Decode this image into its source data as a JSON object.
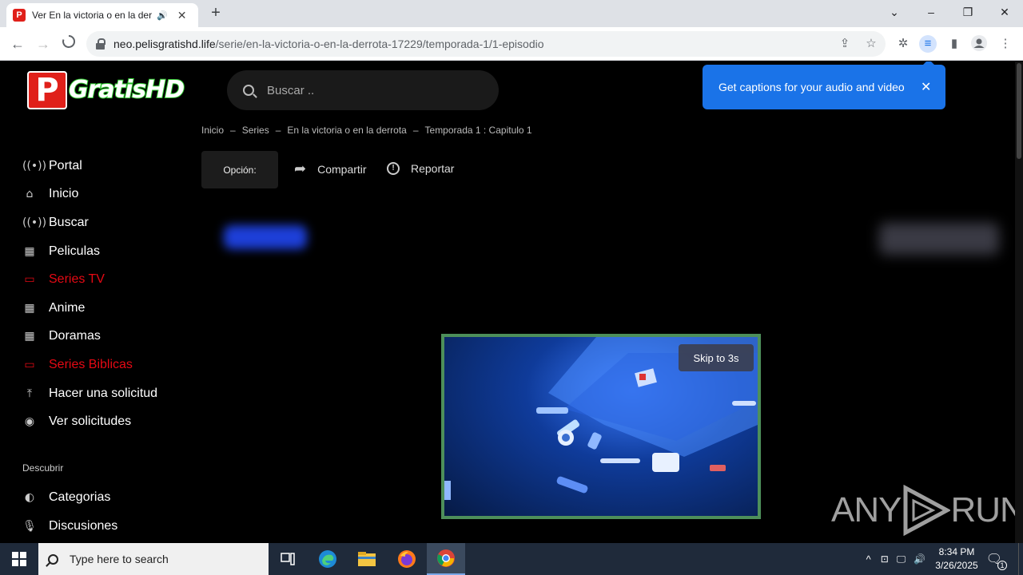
{
  "browser": {
    "tab": {
      "title": "Ver En la victoria o en la derrota",
      "favicon_letter": "P"
    },
    "window_controls": {
      "minimize": "–",
      "restore": "❐",
      "close": "✕"
    },
    "url": {
      "domain": "neo.pelisgratishd.life",
      "path": "/serie/en-la-victoria-o-en-la-derrota-17229/temporada-1/1-episodio"
    }
  },
  "site": {
    "logo": {
      "letter": "P",
      "text": "GratisHD"
    },
    "search": {
      "placeholder": "Buscar .."
    },
    "caption_popup": {
      "text": "Get captions for your audio and video"
    },
    "breadcrumb": [
      "Inicio",
      "Series",
      "En la victoria o en la derrota",
      "Temporada 1 : Capitulo 1"
    ],
    "breadcrumb_sep": "–",
    "actions": {
      "opcion": "Opción:",
      "compartir": "Compartir",
      "reportar": "Reportar"
    },
    "sidebar": {
      "items": [
        {
          "label": "Portal",
          "icon": "broadcast-icon",
          "active": false
        },
        {
          "label": "Inicio",
          "icon": "home-icon",
          "active": false
        },
        {
          "label": "Buscar",
          "icon": "broadcast-icon",
          "active": false
        },
        {
          "label": "Peliculas",
          "icon": "film-icon",
          "active": false
        },
        {
          "label": "Series TV",
          "icon": "tv-icon",
          "active": true
        },
        {
          "label": "Anime",
          "icon": "film-icon",
          "active": false
        },
        {
          "label": "Doramas",
          "icon": "film-icon",
          "active": false
        },
        {
          "label": "Series Biblicas",
          "icon": "tv-icon",
          "active": true
        },
        {
          "label": "Hacer una solicitud",
          "icon": "upload-icon",
          "active": false
        },
        {
          "label": "Ver solicitudes",
          "icon": "eye-icon",
          "active": false
        }
      ],
      "discover_heading": "Descubrir",
      "discover_items": [
        {
          "label": "Categorias",
          "icon": "half-circle-icon"
        },
        {
          "label": "Discusiones",
          "icon": "microphone-icon"
        }
      ]
    },
    "ad": {
      "skip_label": "Skip to 3s"
    },
    "watermark": {
      "left": "ANY",
      "right": "RUN"
    }
  },
  "taskbar": {
    "search_placeholder": "Type here to search",
    "time": "8:34 PM",
    "date": "3/26/2025",
    "notification_count": "1"
  },
  "colors": {
    "accent_red": "#e50914",
    "caption_blue": "#1a73e8",
    "ad_border": "#4d8f5a"
  }
}
